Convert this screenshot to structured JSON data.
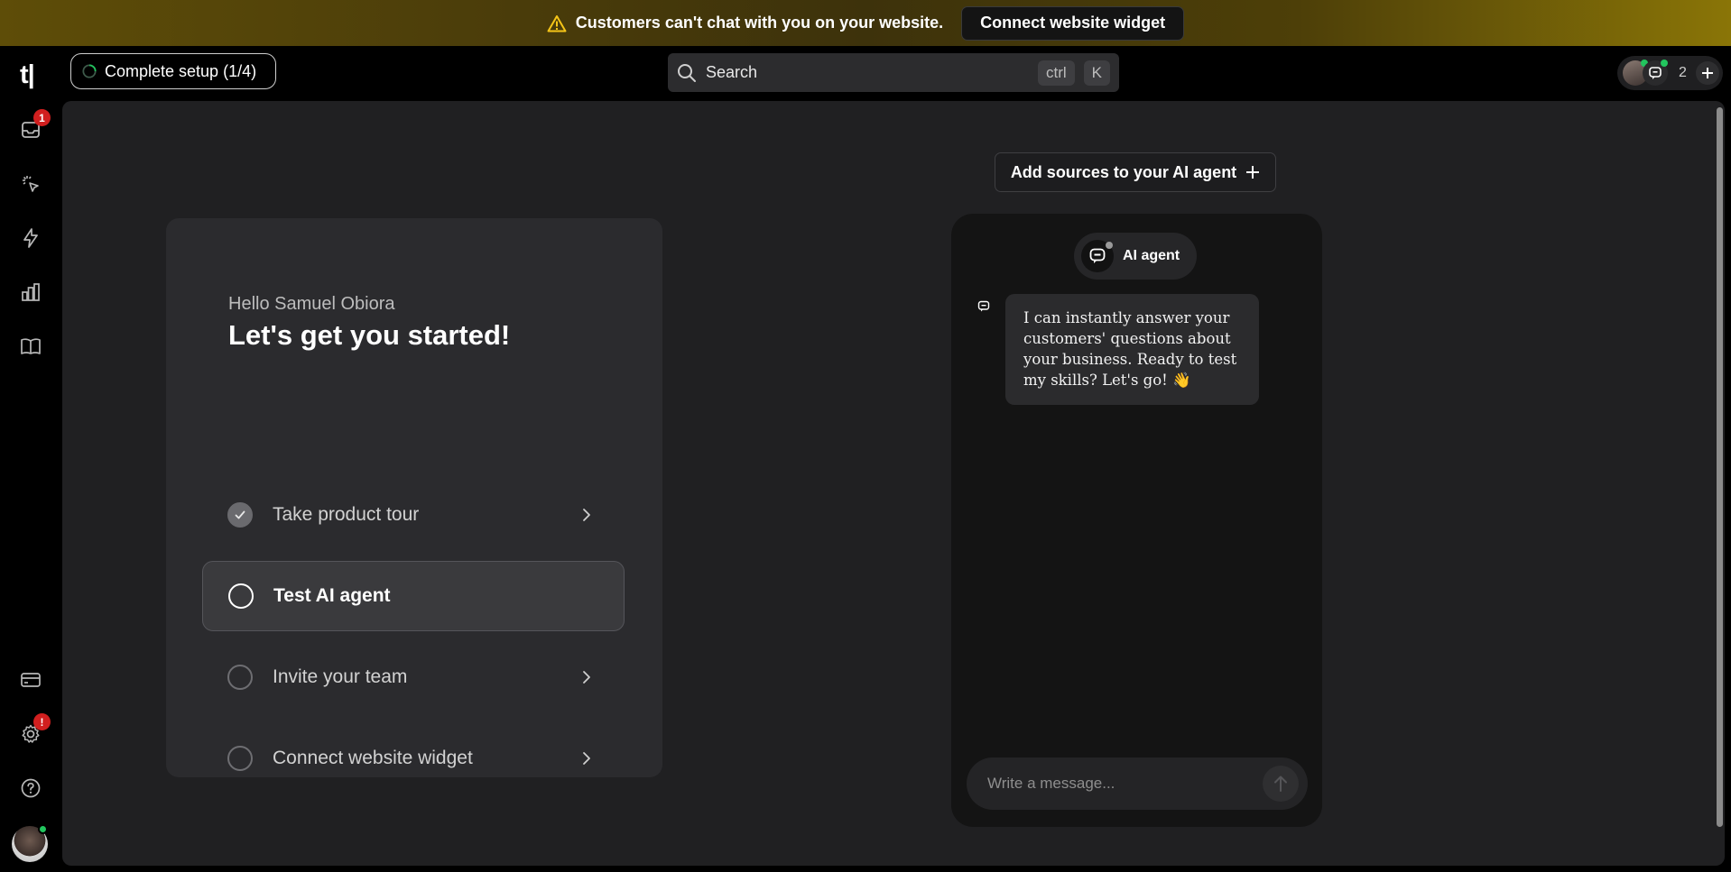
{
  "banner": {
    "warning_text": "Customers can't chat with you on your website.",
    "cta_label": "Connect website widget",
    "icon": "warning-triangle-icon"
  },
  "header": {
    "logo_text": "t|",
    "setup_label": "Complete setup (1/4)",
    "search_label": "Search",
    "search_shortcut": [
      "ctrl",
      "K"
    ],
    "online_count": "2"
  },
  "sidebar": {
    "items": [
      {
        "name": "inbox",
        "icon": "inbox-icon",
        "badge": "1"
      },
      {
        "name": "ai-agent",
        "icon": "sparkle-cursor-icon"
      },
      {
        "name": "automations",
        "icon": "lightning-icon"
      },
      {
        "name": "analytics",
        "icon": "bar-chart-icon"
      },
      {
        "name": "knowledge",
        "icon": "book-icon"
      }
    ],
    "bottom_items": [
      {
        "name": "billing",
        "icon": "credit-card-icon"
      },
      {
        "name": "settings",
        "icon": "gear-icon",
        "badge": "!"
      },
      {
        "name": "help",
        "icon": "help-icon"
      }
    ]
  },
  "onboarding": {
    "greeting": "Hello Samuel Obiora",
    "headline": "Let's get you started!",
    "steps": [
      {
        "label": "Take product tour",
        "state": "done"
      },
      {
        "label": "Test AI agent",
        "state": "active"
      },
      {
        "label": "Invite your team",
        "state": "todo"
      },
      {
        "label": "Connect website widget",
        "state": "todo"
      }
    ]
  },
  "chat": {
    "add_sources_label": "Add sources to your AI agent",
    "agent_name": "AI agent",
    "message": "I can instantly answer your customers' questions about your business. Ready to test my skills? Let's go! 👋",
    "input_placeholder": "Write a message..."
  },
  "colors": {
    "banner_accent": "#8a7507",
    "background": "#000000",
    "panel": "#202022",
    "card": "#2b2b2e",
    "badge_red": "#d11f1f",
    "online_green": "#22c55e"
  }
}
